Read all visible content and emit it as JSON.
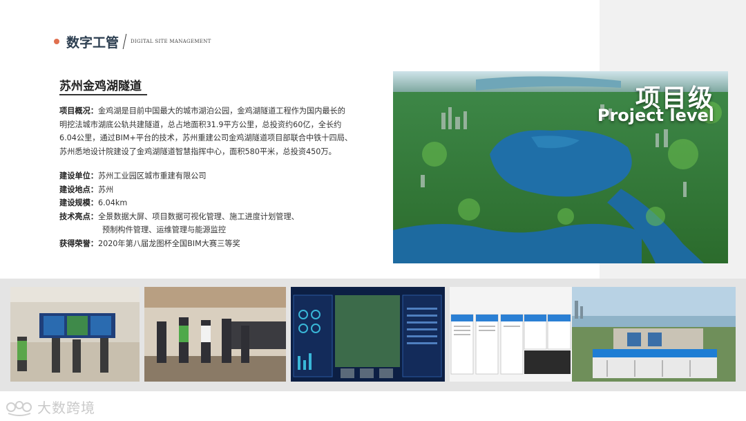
{
  "header": {
    "title": "数字工管",
    "subtitle": "DIGITAL SITE MANAGEMENT"
  },
  "project": {
    "title": "苏州金鸡湖隧道",
    "overview_label": "项目概况：",
    "overview_lines": [
      "金鸡湖是目前中国最大的城市湖泊公园，金鸡湖隧道工程作为国内最长的",
      "明挖法城市湖底公轨共建隧道，总占地面积31.9平方公里，总投资约60亿，全长约",
      "6.04公里，通过BIM+平台的技术，苏州重建公司金鸡湖隧道项目部联合中铁十四局、",
      "苏州悉地设计院建设了金鸡湖隧道智慧指挥中心，面积580平米，总投资450万。"
    ],
    "details": [
      {
        "label": "建设单位：",
        "value": "苏州工业园区城市重建有限公司"
      },
      {
        "label": "建设地点：",
        "value": "苏州"
      },
      {
        "label": "建设规模：",
        "value": "6.04km"
      },
      {
        "label": "技术亮点：",
        "value": "全景数据大屏、项目数据可视化管理、施工进度计划管理、"
      }
    ],
    "highlight_cont": "预制构件管理、运维管理与能源监控",
    "award": {
      "label": "获得荣誉：",
      "value": "2020年第八届龙图杯全国BIM大赛三等奖"
    }
  },
  "hero": {
    "badge_cn": "项目级",
    "badge_en": "Project level"
  },
  "footer": {
    "logo_text": "大数跨境"
  },
  "colors": {
    "accent_dot": "#e0704f",
    "title": "#2c3e50",
    "band": "#e4e4e4"
  }
}
